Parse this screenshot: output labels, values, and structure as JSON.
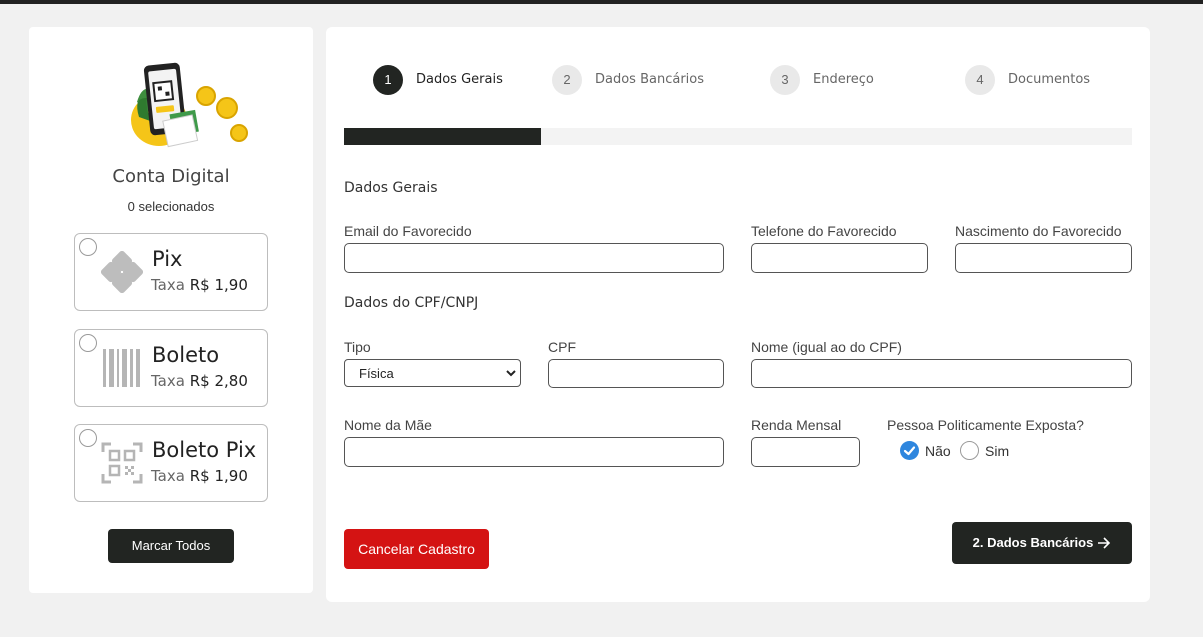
{
  "left": {
    "title": "Conta Digital",
    "selected_count": "0 selecionados",
    "options": [
      {
        "name": "Pix",
        "fee_label": "Taxa",
        "fee_value": "R$ 1,90",
        "icon": "pix-icon"
      },
      {
        "name": "Boleto",
        "fee_label": "Taxa",
        "fee_value": "R$ 2,80",
        "icon": "barcode-icon"
      },
      {
        "name": "Boleto Pix",
        "fee_label": "Taxa",
        "fee_value": "R$ 1,90",
        "icon": "qr-code-icon"
      }
    ],
    "mark_all": "Marcar Todos"
  },
  "steps": [
    {
      "num": "1",
      "label": "Dados Gerais",
      "active": true
    },
    {
      "num": "2",
      "label": "Dados Bancários",
      "active": false
    },
    {
      "num": "3",
      "label": "Endereço",
      "active": false
    },
    {
      "num": "4",
      "label": "Documentos",
      "active": false
    }
  ],
  "progress": {
    "value": 0.25
  },
  "form": {
    "section_general": "Dados Gerais",
    "email_label": "Email do Favorecido",
    "phone_label": "Telefone do Favorecido",
    "birth_label": "Nascimento do Favorecido",
    "section_cpf": "Dados do CPF/CNPJ",
    "type_label": "Tipo",
    "type_value": "Física",
    "cpf_label": "CPF",
    "name_label": "Nome (igual ao do CPF)",
    "mother_label": "Nome da Mãe",
    "income_label": "Renda Mensal",
    "pep_label": "Pessoa Politicamente Exposta?",
    "pep_no": "Não",
    "pep_yes": "Sim",
    "pep_selected": "Não"
  },
  "buttons": {
    "cancel": "Cancelar Cadastro",
    "next": "2. Dados Bancários"
  },
  "colors": {
    "dark": "#222522",
    "cancel_red": "#d41313",
    "radio_blue": "#2e86de",
    "coin_yellow": "#f5c518"
  }
}
